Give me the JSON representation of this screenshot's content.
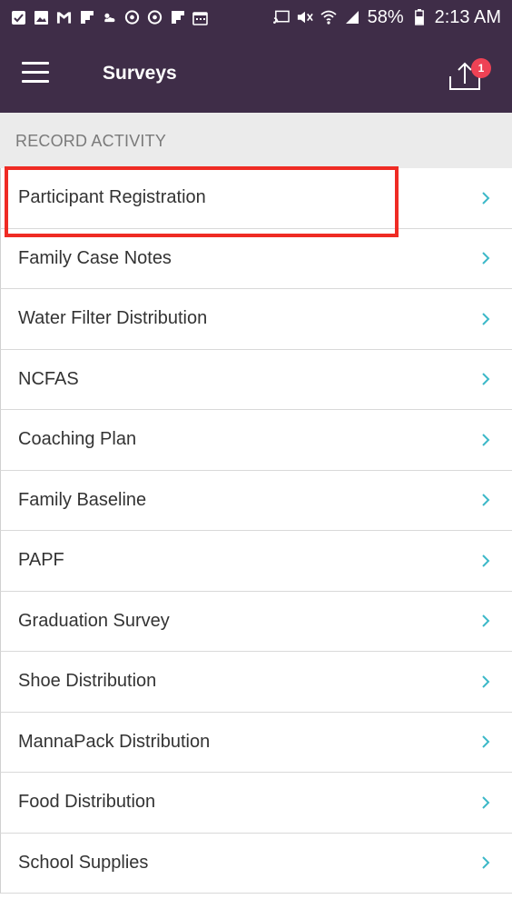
{
  "status_bar": {
    "battery": "58%",
    "time": "2:13 AM"
  },
  "app_bar": {
    "title": "Surveys",
    "upload_badge": "1"
  },
  "section": {
    "header": "RECORD ACTIVITY"
  },
  "surveys": [
    "Participant Registration",
    "Family Case Notes",
    "Water Filter Distribution",
    "NCFAS",
    "Coaching Plan",
    "Family Baseline",
    "PAPF",
    "Graduation Survey",
    "Shoe Distribution",
    "MannaPack Distribution",
    "Food Distribution",
    "School Supplies"
  ],
  "colors": {
    "app_bar": "#3f2d48",
    "badge": "#ee4255",
    "chevron": "#3cb8c8",
    "highlight": "#ef2b24"
  }
}
